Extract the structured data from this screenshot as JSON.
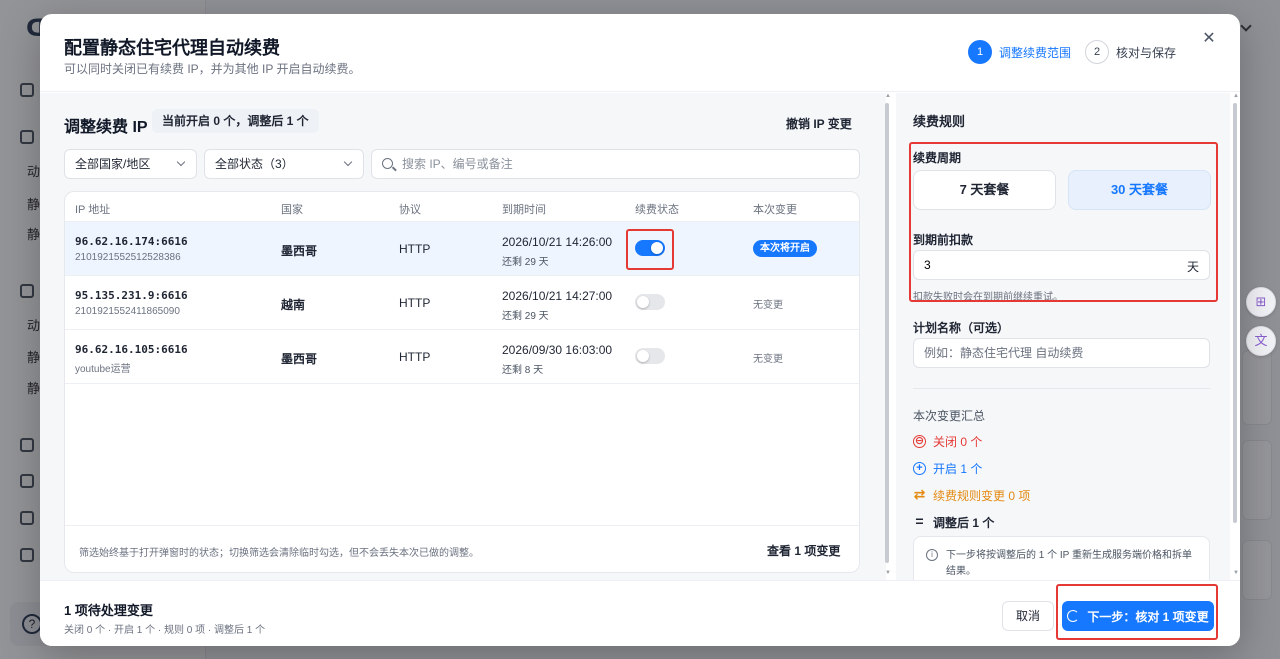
{
  "background": {
    "nav_labels": [
      "动",
      "静",
      "静",
      "动",
      "静",
      "静"
    ]
  },
  "modal": {
    "title": "配置静态住宅代理自动续费",
    "subtitle": "可以同时关闭已有续费 IP，并为其他 IP 开启自动续费。",
    "steps": [
      {
        "num": "1",
        "label": "调整续费范围"
      },
      {
        "num": "2",
        "label": "核对与保存"
      }
    ],
    "close_glyph": "✕"
  },
  "left": {
    "title": "调整续费 IP",
    "count_pill": "当前开启 0 个，调整后 1 个",
    "undo": "撤销 IP 变更",
    "filter_country": "全部国家/地区",
    "filter_status": "全部状态（3）",
    "search_placeholder": "搜索 IP、编号或备注",
    "columns": [
      "IP 地址",
      "国家",
      "协议",
      "到期时间",
      "续费状态",
      "本次变更"
    ],
    "rows": [
      {
        "ip": "96.62.16.174:6616",
        "sub": "2101921552512528386",
        "country": "墨西哥",
        "protocol": "HTTP",
        "expiry": "2026/10/21 14:26:00",
        "remaining": "还剩 29 天",
        "change": "本次将开启"
      },
      {
        "ip": "95.135.231.9:6616",
        "sub": "2101921552411865090",
        "country": "越南",
        "protocol": "HTTP",
        "expiry": "2026/10/21 14:27:00",
        "remaining": "还剩 29 天",
        "change": "无变更"
      },
      {
        "ip": "96.62.16.105:6616",
        "sub": "youtube运营",
        "country": "墨西哥",
        "protocol": "HTTP",
        "expiry": "2026/09/30 16:03:00",
        "remaining": "还剩 8 天",
        "change": "无变更"
      }
    ],
    "renew_on": [
      true,
      false,
      false
    ],
    "foot_note": "筛选始终基于打开弹窗时的状态；切换筛选会清除临时勾选，但不会丢失本次已做的调整。",
    "view_changes": "查看 1 项变更"
  },
  "right": {
    "title": "续费规则",
    "period_label": "续费周期",
    "plan_7": "7 天套餐",
    "plan_30": "30 天套餐",
    "selected_plan": "30 天套餐",
    "deduct_label": "到期前扣款",
    "deduct_days": "3",
    "deduct_unit": "天",
    "deduct_hint": "扣款失败时会在到期前继续重试。",
    "name_label": "计划名称（可选）",
    "name_placeholder": "例如：静态住宅代理 自动续费",
    "summary_title": "本次变更汇总",
    "summary": {
      "close": "关闭 0 个",
      "open": "开启 1 个",
      "rules": "续费规则变更 0 项",
      "after": "调整后 1 个"
    },
    "summary_icons": {
      "close": "⊖",
      "open": "+",
      "rules": "⇄",
      "after": "="
    },
    "info": "下一步将按调整后的 1 个 IP 重新生成服务端价格和拆单结果。"
  },
  "footer": {
    "pending": "1 项待处理变更",
    "pending_sub": "关闭 0 个 · 开启 1 个 · 规则 0 项 · 调整后 1 个",
    "cancel": "取消",
    "next": "下一步：核对 1 项变更"
  },
  "colors": {
    "accent": "#1677ff",
    "danger": "#e53935",
    "warning": "#e38a12",
    "highlight_box": "#e53935"
  }
}
